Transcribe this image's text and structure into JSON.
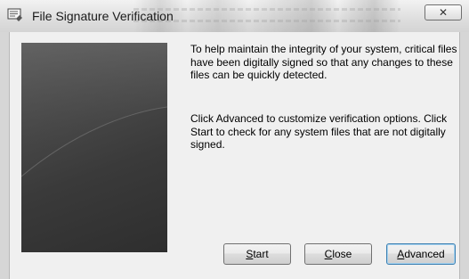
{
  "window": {
    "title": "File Signature Verification",
    "close_glyph": "✕"
  },
  "content": {
    "paragraph1": "To help maintain the integrity of your system, critical files have been digitally signed so that any changes to these files can be quickly detected.",
    "paragraph2": "Click Advanced to customize verification options. Click Start to check for any system files that are not digitally signed."
  },
  "buttons": {
    "start": {
      "mnemonic": "S",
      "rest": "tart"
    },
    "close": {
      "mnemonic": "C",
      "rest": "lose"
    },
    "advanced": {
      "mnemonic": "A",
      "rest": "dvanced"
    }
  },
  "icons": {
    "app": "signature-verification-icon",
    "close": "close-icon"
  },
  "colors": {
    "titlebar": "#dedede",
    "client_bg": "#f0f0f0",
    "banner": "#3a3a3a",
    "default_button_border": "#3c7fb1"
  }
}
